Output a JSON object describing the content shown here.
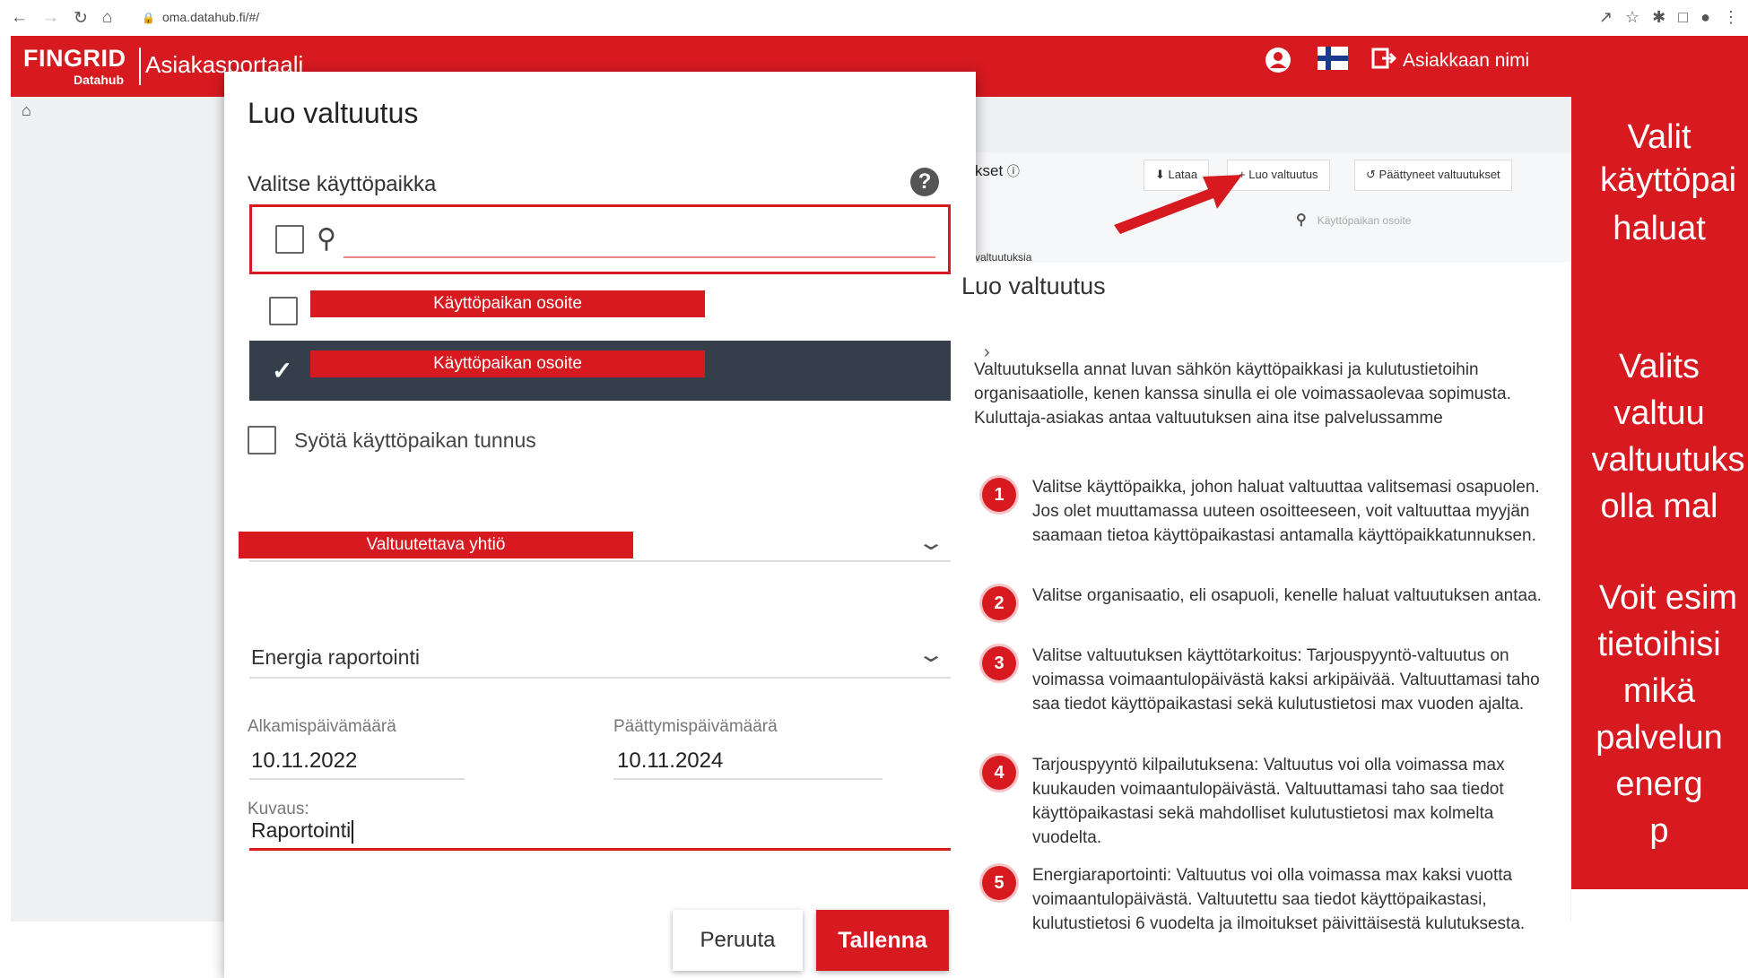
{
  "browser": {
    "url": "oma.datahub.fi/#/",
    "nav_icons": [
      "back-icon",
      "forward-icon",
      "reload-icon",
      "home-icon"
    ],
    "extension_icons": [
      "share-icon",
      "star-icon",
      "puzzle-icon",
      "window-icon",
      "profile-icon",
      "menu-icon"
    ]
  },
  "header": {
    "brand": "FINGRID",
    "brand_sub": "Datahub",
    "app_name": "Asiakasportaali",
    "customer_name": "Asiakkaan nimi",
    "icons": [
      "account-icon",
      "finland-flag-icon",
      "logout-icon"
    ]
  },
  "background": {
    "panel_title": "kset",
    "buttons": [
      {
        "label": "Lataa",
        "icon": "download-icon"
      },
      {
        "label": "Luo valtuutus",
        "icon": "plus-icon"
      },
      {
        "label": "Päättyneet valtuutukset",
        "icon": "history-icon"
      }
    ],
    "filter_placeholder": "Käyttöpaikan osoite",
    "no_permissions_text": "valtuutuksia"
  },
  "modal": {
    "title": "Luo valtuutus",
    "location_label": "Valitse käyttöpaikka",
    "options": [
      {
        "label": "Käyttöpaikan osoite",
        "checked": false
      },
      {
        "label": "Käyttöpaikan osoite",
        "checked": true
      }
    ],
    "manual_entry_label": "Syötä käyttöpaikan tunnus",
    "company_label": "Valtuutettava yhtiö",
    "purpose_value": "Energia raportointi",
    "start_date_label": "Alkamispäivämäärä",
    "start_date_value": "10.11.2022",
    "end_date_label": "Päättymispäivämäärä",
    "end_date_value": "10.11.2024",
    "description_label": "Kuvaus:",
    "description_value": "Raportointi",
    "cancel_label": "Peruuta",
    "save_label": "Tallenna"
  },
  "info": {
    "title": "Luo valtuutus",
    "intro": "Valtuutuksella annat luvan sähkön käyttöpaikkasi ja kulutustietoihin organisaatiolle, kenen kanssa sinulla ei ole voimassaolevaa sopimusta. Kuluttaja-asiakas antaa valtuutuksen aina itse palvelussamme",
    "steps": [
      {
        "num": "1",
        "text": "Valitse käyttöpaikka, johon haluat valtuuttaa valitsemasi osapuolen. Jos olet muuttamassa uuteen osoitteeseen, voit valtuuttaa myyjän saamaan tietoa käyttöpaikastasi antamalla käyttöpaikkatunnuksen."
      },
      {
        "num": "2",
        "text": "Valitse organisaatio, eli osapuoli, kenelle haluat valtuutuksen antaa."
      },
      {
        "num": "3",
        "text": "Valitse valtuutuksen käyttötarkoitus: Tarjouspyyntö-valtuutus on voimassa voimaantulopäivästä kaksi arkipäivää. Valtuuttamasi taho saa tiedot käyttöpaikastasi sekä kulutustietosi max vuoden ajalta."
      },
      {
        "num": "4",
        "text": "Tarjouspyyntö kilpailutuksena: Valtuutus voi olla voimassa max kuukauden voimaantulopäivästä. Valtuuttamasi taho saa tiedot käyttöpaikastasi sekä mahdolliset kulutustietosi max kolmelta vuodelta."
      },
      {
        "num": "5",
        "text": "Energiaraportointi: Valtuutus voi olla voimassa max kaksi vuotta voimaantulopäivästä. Valtuutettu saa tiedot käyttöpaikastasi, kulutustietosi 6 vuodelta ja ilmoitukset päivittäisestä kulutuksesta."
      }
    ]
  },
  "side_text": {
    "lines": [
      "Valit",
      "käyttöpai",
      "haluat",
      "Valits",
      "valtuu",
      "valtuutuks",
      "olla mal",
      "Voit esim",
      "tietoihisi",
      "mikä",
      "palvelun",
      "energ",
      "p"
    ]
  },
  "colors": {
    "brand_red": "#d71920",
    "selected_row": "#343f4b"
  }
}
